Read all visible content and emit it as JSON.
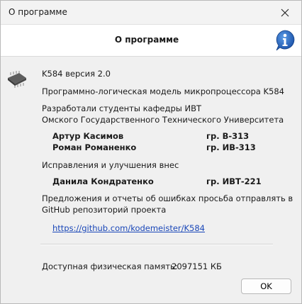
{
  "window": {
    "title": "О программе"
  },
  "header": {
    "title": "О программе"
  },
  "about": {
    "version": "K584 версия 2.0",
    "description": "Программно-логическая модель микропроцессора K584",
    "developed_line1": "Разработали студенты кафедры ИВТ",
    "developed_line2": "Омского Государственного Технического Университета",
    "authors": [
      {
        "name": "Артур Касимов",
        "group": "гр. В-313"
      },
      {
        "name": "Роман Романенко",
        "group": "гр. ИВ-313"
      }
    ],
    "improvements_label": "Исправления и улучшения внес",
    "improver": {
      "name": "Данила Кондратенко",
      "group": "гр. ИВТ-221"
    },
    "feedback_line1": "Предложения и отчеты об ошибках просьба отправлять в",
    "feedback_line2": "GitHub репозиторий проекта",
    "repo_link": "https://github.com/kodemeister/K584",
    "memory_label": "Доступная физическая память:",
    "memory_value": "2097151 КБ"
  },
  "buttons": {
    "ok": "OK"
  },
  "icons": {
    "close": "close-icon",
    "info": "info-icon",
    "chip": "chip-icon"
  },
  "colors": {
    "link": "#1a47b8",
    "info_blue": "#1f5fb8"
  }
}
